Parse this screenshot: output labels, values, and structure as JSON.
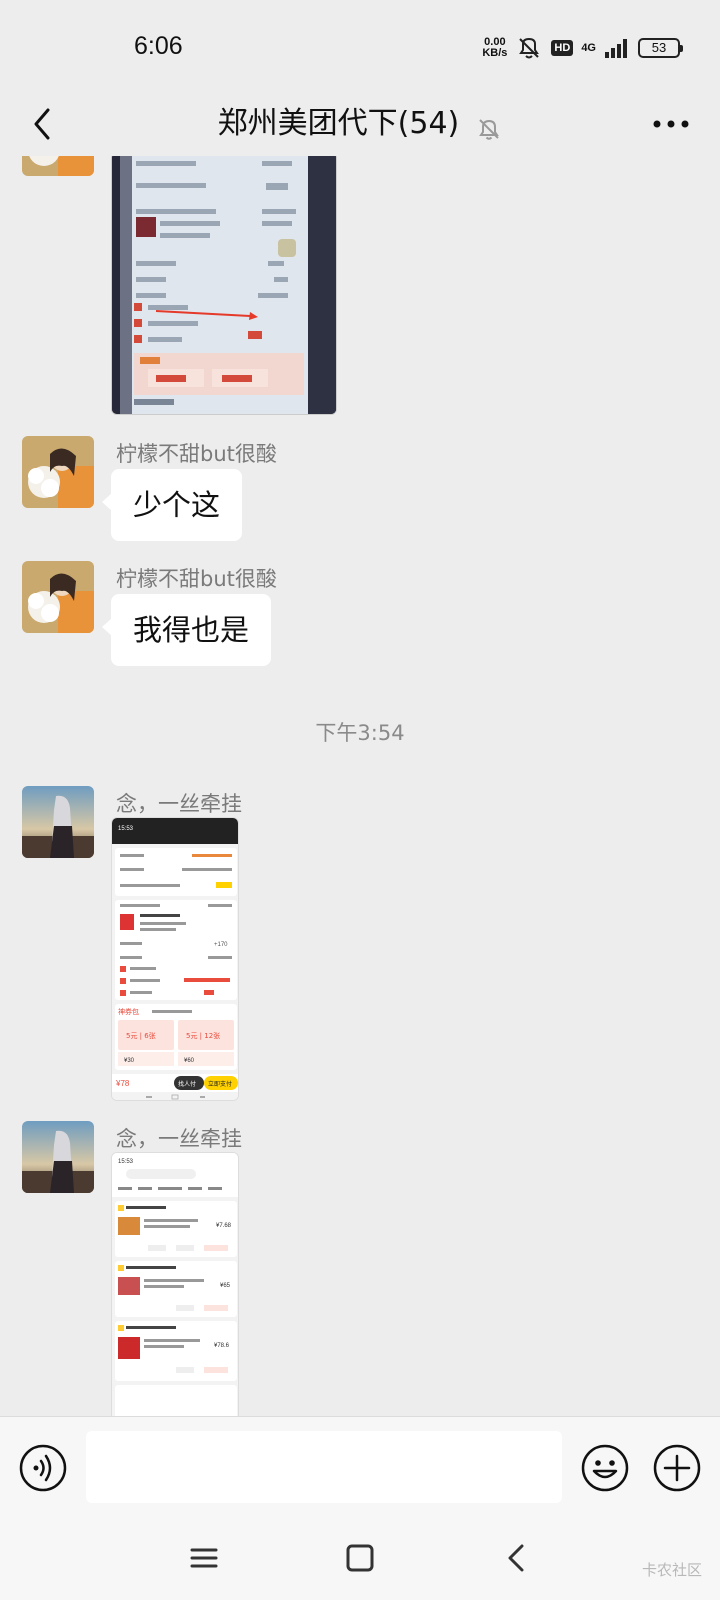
{
  "status_bar": {
    "time": "6:06",
    "net_speed_value": "0.00",
    "net_speed_unit": "KB/s",
    "hd_badge": "HD",
    "network": "4G",
    "battery": "53"
  },
  "header": {
    "title": "郑州美团代下(54)"
  },
  "messages": [
    {
      "sender": "柠檬不甜but很酸",
      "text": "少个这"
    },
    {
      "sender": "柠檬不甜but很酸",
      "text": "我得也是"
    },
    {
      "timestamp": "下午3:54"
    },
    {
      "sender": "念，一丝牵挂"
    },
    {
      "sender": "念，一丝牵挂"
    }
  ],
  "screenshot2": {
    "time": "15:53",
    "total": "+170",
    "pay_total": "¥78",
    "cta_friend": "找人付",
    "cta_pay": "立即支付",
    "coupon_title": "神券包",
    "coupons": [
      "5元 | 6张",
      "5元 | 12张"
    ],
    "coupon_prices": [
      "¥30",
      "¥60"
    ]
  },
  "screenshot3": {
    "time": "15:53",
    "prices": [
      "¥7.68",
      "¥65",
      "¥78.6"
    ]
  },
  "input_bar": {
    "placeholder": ""
  },
  "watermark": "卡农社区",
  "colors": {
    "background": "#ededed",
    "bubble": "#ffffff",
    "accent_yellow": "#ffd100",
    "accent_red": "#e94b3c"
  },
  "icons": {
    "back": "chevron-left-icon",
    "mute": "bell-off-icon",
    "more": "more-dots-icon",
    "voice": "voice-icon",
    "emoji": "emoji-icon",
    "plus": "plus-circle-icon",
    "menu": "menu-icon",
    "home": "home-icon",
    "back_nav": "back-triangle-icon"
  }
}
